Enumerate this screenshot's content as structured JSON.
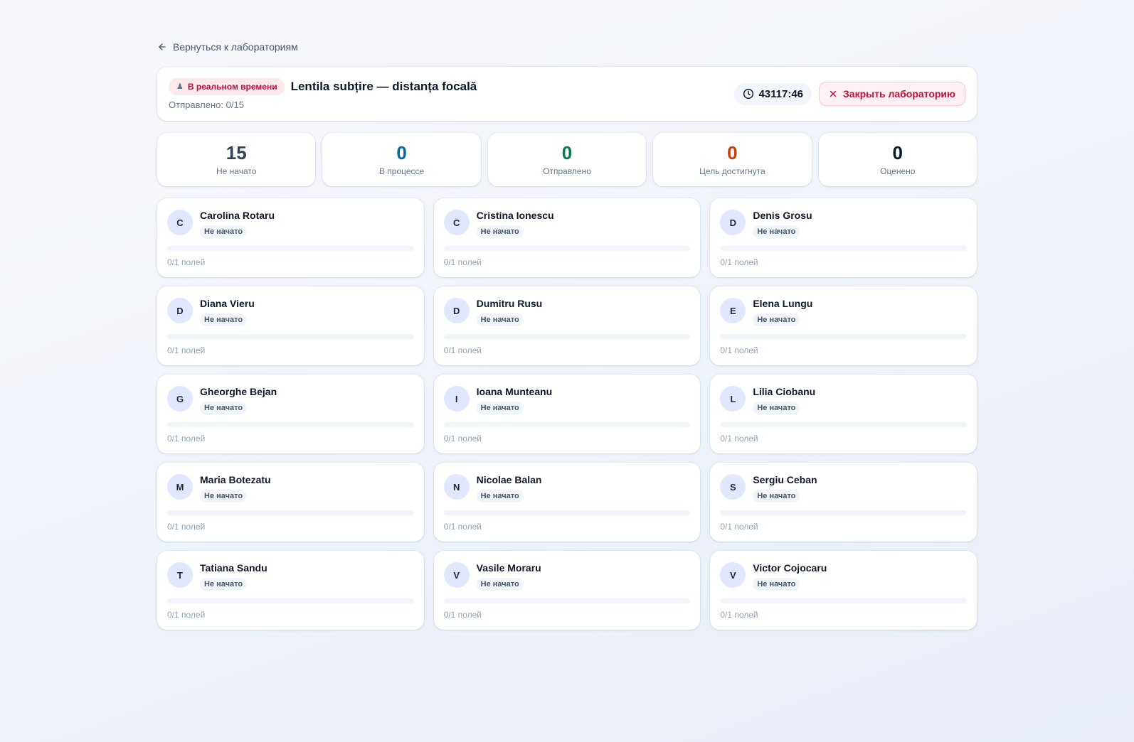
{
  "nav": {
    "back_label": "Вернуться к лабораториям"
  },
  "header": {
    "live_badge": "В реальном времени",
    "title": "Lentila subțire — distanța focală",
    "submitted": "Отправлено: 0/15",
    "timer": "43117:46",
    "close_label": "Закрыть лабораторию"
  },
  "stats": [
    {
      "value": "15",
      "label": "Не начато",
      "color": "#334155"
    },
    {
      "value": "0",
      "label": "В процессе",
      "color": "#0369a1"
    },
    {
      "value": "0",
      "label": "Отправлено",
      "color": "#047857"
    },
    {
      "value": "0",
      "label": "Цель достигнута",
      "color": "#c2410c"
    },
    {
      "value": "0",
      "label": "Оценено",
      "color": "#0f172a"
    }
  ],
  "students": [
    {
      "initial": "C",
      "name": "Carolina Rotaru",
      "status": "Не начато",
      "fields": "0/1 полей",
      "progress": 0
    },
    {
      "initial": "C",
      "name": "Cristina Ionescu",
      "status": "Не начато",
      "fields": "0/1 полей",
      "progress": 0
    },
    {
      "initial": "D",
      "name": "Denis Grosu",
      "status": "Не начато",
      "fields": "0/1 полей",
      "progress": 0
    },
    {
      "initial": "D",
      "name": "Diana Vieru",
      "status": "Не начато",
      "fields": "0/1 полей",
      "progress": 0
    },
    {
      "initial": "D",
      "name": "Dumitru Rusu",
      "status": "Не начато",
      "fields": "0/1 полей",
      "progress": 0
    },
    {
      "initial": "E",
      "name": "Elena Lungu",
      "status": "Не начато",
      "fields": "0/1 полей",
      "progress": 0
    },
    {
      "initial": "G",
      "name": "Gheorghe Bejan",
      "status": "Не начато",
      "fields": "0/1 полей",
      "progress": 0
    },
    {
      "initial": "I",
      "name": "Ioana Munteanu",
      "status": "Не начато",
      "fields": "0/1 полей",
      "progress": 0
    },
    {
      "initial": "L",
      "name": "Lilia Ciobanu",
      "status": "Не начато",
      "fields": "0/1 полей",
      "progress": 0
    },
    {
      "initial": "M",
      "name": "Maria Botezatu",
      "status": "Не начато",
      "fields": "0/1 полей",
      "progress": 0
    },
    {
      "initial": "N",
      "name": "Nicolae Balan",
      "status": "Не начато",
      "fields": "0/1 полей",
      "progress": 0
    },
    {
      "initial": "S",
      "name": "Sergiu Ceban",
      "status": "Не начато",
      "fields": "0/1 полей",
      "progress": 0
    },
    {
      "initial": "T",
      "name": "Tatiana Sandu",
      "status": "Не начато",
      "fields": "0/1 полей",
      "progress": 0
    },
    {
      "initial": "V",
      "name": "Vasile Moraru",
      "status": "Не начато",
      "fields": "0/1 полей",
      "progress": 0
    },
    {
      "initial": "V",
      "name": "Victor Cojocaru",
      "status": "Не начато",
      "fields": "0/1 полей",
      "progress": 0
    }
  ]
}
